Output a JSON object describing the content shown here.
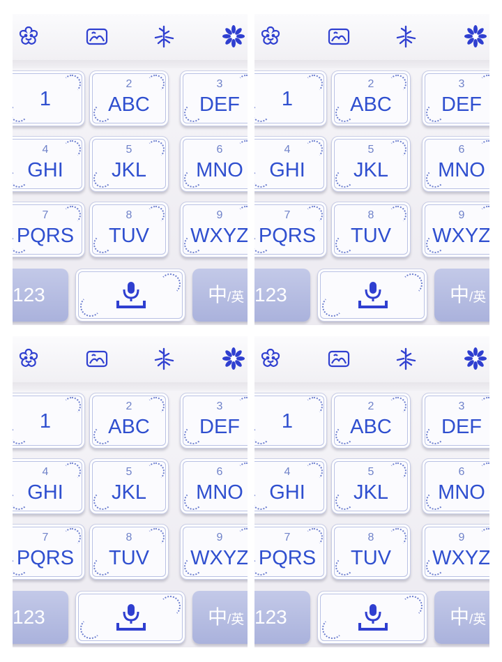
{
  "keyboard": {
    "toolbar_icons": [
      "flower-face-icon",
      "image-icon",
      "bamboo-icon",
      "chrysanthemum-icon"
    ],
    "keys": [
      {
        "num": "",
        "letters": "1"
      },
      {
        "num": "2",
        "letters": "ABC"
      },
      {
        "num": "3",
        "letters": "DEF"
      },
      {
        "num": "4",
        "letters": "GHI"
      },
      {
        "num": "5",
        "letters": "JKL"
      },
      {
        "num": "6",
        "letters": "MNO"
      },
      {
        "num": "7",
        "letters": "PQRS"
      },
      {
        "num": "8",
        "letters": "TUV"
      },
      {
        "num": "9",
        "letters": "WXYZ"
      }
    ],
    "numbers_key": "123",
    "voice_key_icon": "microphone-icon",
    "lang_key_main": "中",
    "lang_key_secondary": "/英"
  },
  "colors": {
    "key_text": "#2f4fcf",
    "key_number": "#6f82c9",
    "function_key": "#aab2dc",
    "accent": "#2f3fd0"
  }
}
